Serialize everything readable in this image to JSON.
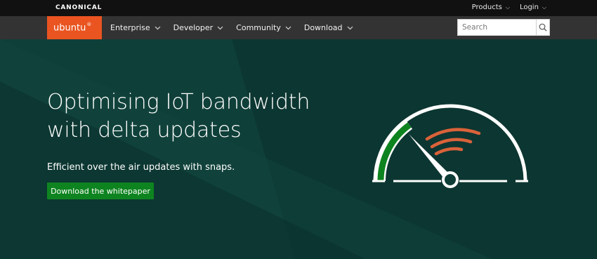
{
  "top_bar": {
    "brand": "CANONICAL",
    "links": [
      {
        "label": "Products"
      },
      {
        "label": "Login"
      }
    ]
  },
  "nav": {
    "logo_text": "ubuntu",
    "logo_mark": "®",
    "items": [
      {
        "label": "Enterprise"
      },
      {
        "label": "Developer"
      },
      {
        "label": "Community"
      },
      {
        "label": "Download"
      }
    ],
    "search": {
      "placeholder": "Search",
      "value": ""
    }
  },
  "hero": {
    "title_line1": "Optimising IoT bandwidth",
    "title_line2": "with delta updates",
    "subtitle": "Efficient over the air updates with snaps.",
    "cta_label": "Download the whitepaper"
  },
  "colors": {
    "ubuntu_orange": "#e95420",
    "hero_bg": "#0e3c36",
    "cta_green": "#0e8420",
    "gauge_green": "#0e8420",
    "signal_orange": "#d9623a"
  },
  "icons": {
    "chevron": "chevron-down-icon",
    "search": "search-icon",
    "gauge": "speedometer-icon"
  }
}
